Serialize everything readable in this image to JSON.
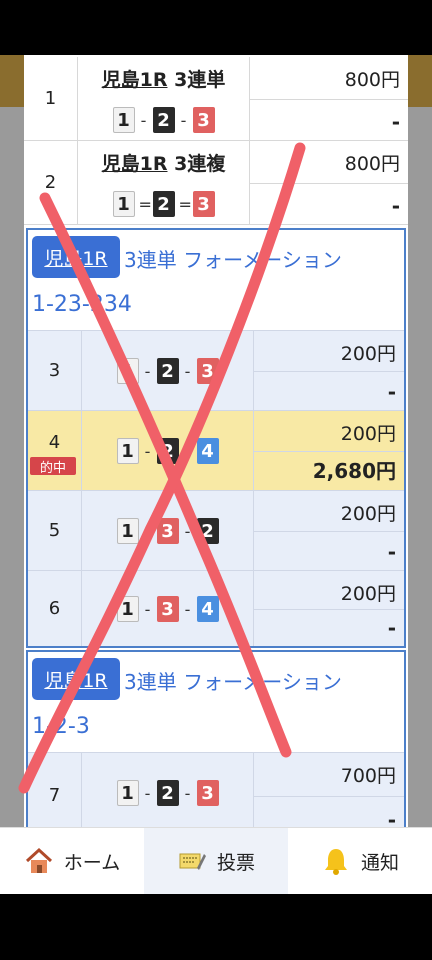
{
  "rows": [
    {
      "no": "1",
      "race": "児島1R",
      "type": "3連単",
      "sep": "-",
      "picks": [
        "1",
        "2",
        "3"
      ],
      "bet": "800円",
      "payout": "-"
    },
    {
      "no": "2",
      "race": "児島1R",
      "type": "3連複",
      "sep": "=",
      "picks": [
        "1",
        "2",
        "3"
      ],
      "bet": "800円",
      "payout": "-"
    }
  ],
  "groups": [
    {
      "race": "児島1R",
      "title": "3連単 フォーメーション",
      "combo": "1-23-234",
      "rows": [
        {
          "no": "3",
          "picks": [
            "1",
            "2",
            "3"
          ],
          "bet": "200円",
          "payout": "-",
          "hit": false
        },
        {
          "no": "4",
          "picks": [
            "1",
            "2",
            "4"
          ],
          "bet": "200円",
          "payout": "2,680円",
          "hit": true,
          "badge": "的中"
        },
        {
          "no": "5",
          "picks": [
            "1",
            "3",
            "2"
          ],
          "bet": "200円",
          "payout": "-",
          "hit": false
        },
        {
          "no": "6",
          "picks": [
            "1",
            "3",
            "4"
          ],
          "bet": "200円",
          "payout": "-",
          "hit": false
        }
      ]
    },
    {
      "race": "児島1R",
      "title": "3連単 フォーメーション",
      "combo": "1-2-3",
      "rows": [
        {
          "no": "7",
          "picks": [
            "1",
            "2",
            "3"
          ],
          "bet": "700円",
          "payout": "-",
          "hit": false
        }
      ]
    }
  ],
  "nav": [
    {
      "label": "ホーム",
      "icon": "home-icon"
    },
    {
      "label": "投票",
      "icon": "ticket-icon"
    },
    {
      "label": "通知",
      "icon": "bell-icon"
    }
  ],
  "colors": {
    "accent": "#3a6fd4",
    "hit": "#f8e9a5",
    "badge": "#d6454a",
    "pick1": "#f2f2f2",
    "pick2": "#2a2a2a",
    "pick3": "#e06160",
    "pick4": "#4a8fe0",
    "xmark": "#f06068"
  }
}
